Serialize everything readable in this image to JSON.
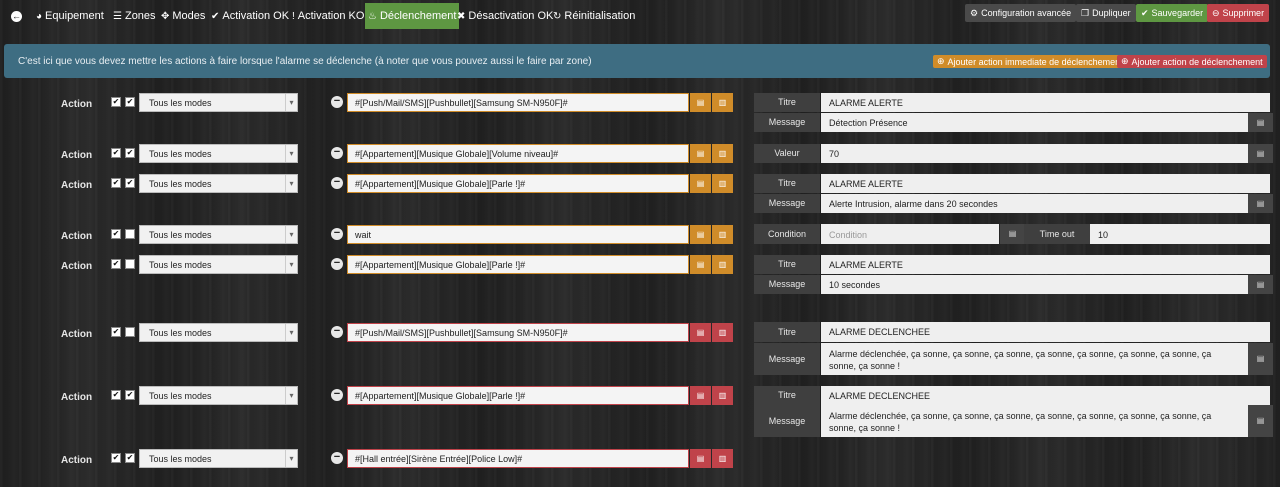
{
  "nav": {
    "back_icon": "arrow-left-icon",
    "tabs": [
      {
        "label": "Equipement",
        "icon": "dashboard-icon"
      },
      {
        "label": "Zones",
        "icon": "list-icon"
      },
      {
        "label": "Modes",
        "icon": "arrows-icon"
      },
      {
        "label": "Activation OK",
        "icon": "check-icon"
      },
      {
        "label": "Activation KO",
        "icon": "exclamation-icon"
      },
      {
        "label": "Déclenchement",
        "icon": "bell-icon"
      },
      {
        "label": "Désactivation OK",
        "icon": "times-icon"
      },
      {
        "label": "Réinitialisation",
        "icon": "refresh-icon"
      }
    ],
    "active_tab": "Déclenchement",
    "actions": {
      "config": "Configuration avancée",
      "duplicate": "Dupliquer",
      "save": "Sauvegarder",
      "delete": "Supprimer"
    }
  },
  "info": {
    "text": "C'est ici que vous devez mettre les actions à faire lorsque l'alarme se déclenche (à noter que vous pouvez aussi le faire par zone)",
    "add_immediate": "Ajouter action immediate de déclenchement",
    "add_action": "Ajouter action de déclenchement"
  },
  "colors": {
    "accent_green": "#5e9742",
    "warning": "#d08c29",
    "danger": "#c0434a",
    "info_bg": "#3e6d82"
  },
  "actions": [
    {
      "label": "Action",
      "mode": "Tous les modes",
      "cb1": true,
      "cb2": true,
      "cmd": "#[Push/Mail/SMS][Pushbullet][Samsung SM-N950F]#",
      "state": "warn",
      "params": [
        {
          "label": "Titre",
          "value": "ALARME ALERTE"
        },
        {
          "label": "Message",
          "value": "Détection Présence"
        }
      ]
    },
    {
      "label": "Action",
      "mode": "Tous les modes",
      "cb1": true,
      "cb2": true,
      "cmd": "#[Appartement][Musique Globale][Volume niveau]#",
      "state": "warn",
      "params": [
        {
          "label": "Valeur",
          "value": "70"
        }
      ]
    },
    {
      "label": "Action",
      "mode": "Tous les modes",
      "cb1": true,
      "cb2": true,
      "cmd": "#[Appartement][Musique Globale][Parle !]#",
      "state": "warn",
      "params": [
        {
          "label": "Titre",
          "value": "ALARME ALERTE"
        },
        {
          "label": "Message",
          "value": "Alerte Intrusion, alarme dans 20 secondes"
        }
      ]
    },
    {
      "label": "Action",
      "mode": "Tous les modes",
      "cb1": true,
      "cb2": false,
      "cmd": "wait",
      "state": "warn",
      "params": [
        {
          "label": "Condition",
          "value": "",
          "placeholder": "Condition"
        },
        {
          "label": "Time out",
          "value": "10"
        }
      ]
    },
    {
      "label": "Action",
      "mode": "Tous les modes",
      "cb1": true,
      "cb2": false,
      "cmd": "#[Appartement][Musique Globale][Parle !]#",
      "state": "warn",
      "params": [
        {
          "label": "Titre",
          "value": "ALARME ALERTE"
        },
        {
          "label": "Message",
          "value": "10 secondes"
        }
      ]
    },
    {
      "label": "Action",
      "mode": "Tous les modes",
      "cb1": true,
      "cb2": false,
      "cmd": "#[Push/Mail/SMS][Pushbullet][Samsung SM-N950F]#",
      "state": "err",
      "params": [
        {
          "label": "Titre",
          "value": "ALARME DECLENCHEE"
        },
        {
          "label": "Message",
          "value": "Alarme déclenchée, ça sonne, ça sonne, ça sonne, ça sonne, ça sonne, ça sonne, ça sonne, ça sonne, ça sonne !"
        }
      ]
    },
    {
      "label": "Action",
      "mode": "Tous les modes",
      "cb1": true,
      "cb2": true,
      "cmd": "#[Appartement][Musique Globale][Parle !]#",
      "state": "err",
      "params": [
        {
          "label": "Titre",
          "value": "ALARME DECLENCHEE"
        },
        {
          "label": "Message",
          "value": "Alarme déclenchée, ça sonne, ça sonne, ça sonne, ça sonne, ça sonne, ça sonne, ça sonne, ça sonne, ça sonne !"
        }
      ]
    },
    {
      "label": "Action",
      "mode": "Tous les modes",
      "cb1": true,
      "cb2": true,
      "cmd": "#[Hall entrée][Sirène Entrée][Police Low]#",
      "state": "err",
      "params": []
    }
  ]
}
